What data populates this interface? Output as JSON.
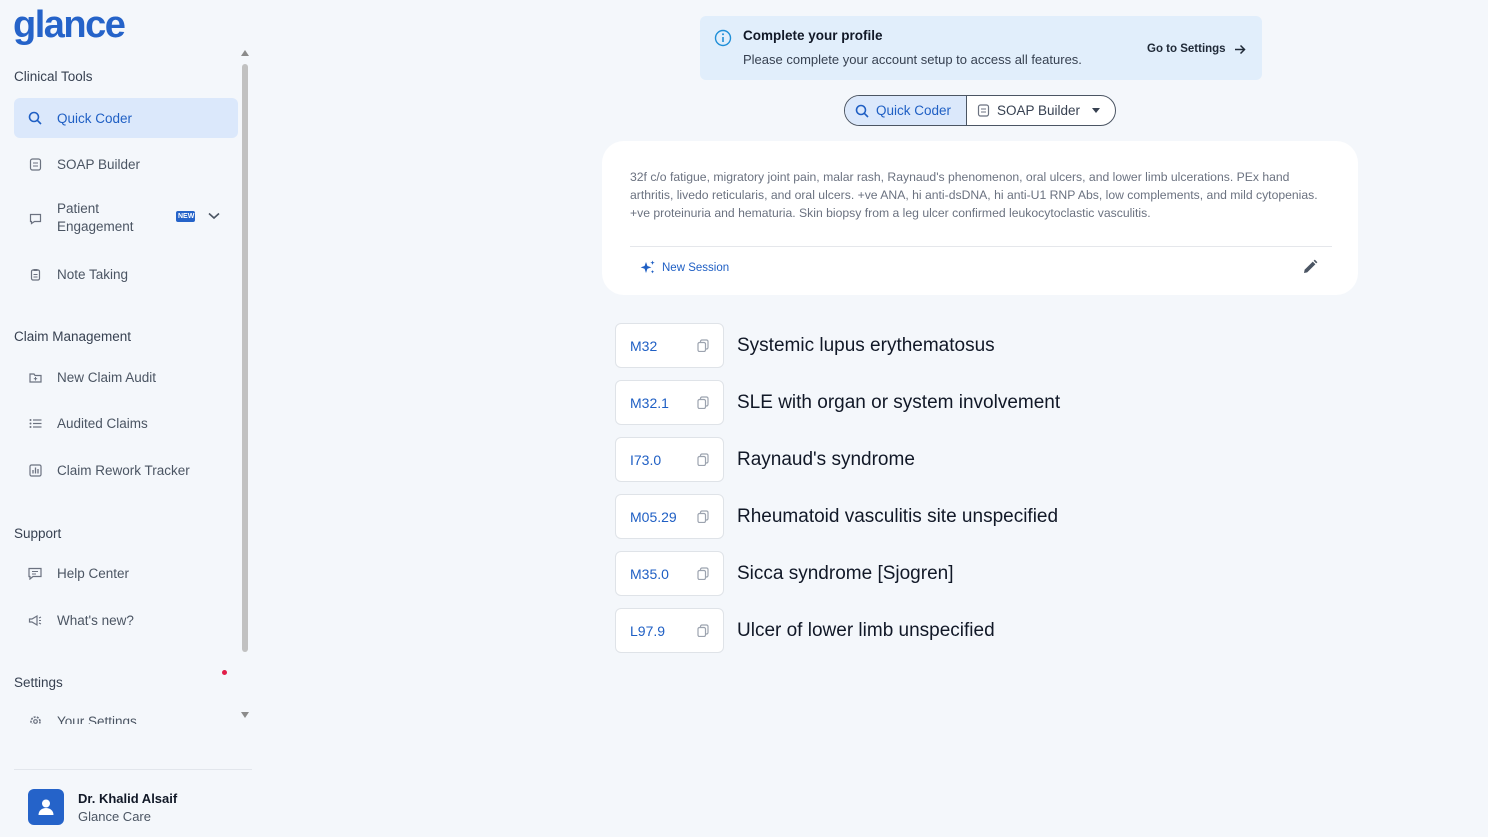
{
  "app": {
    "logo": "glance"
  },
  "sidebar": {
    "sections": [
      {
        "title": "Clinical Tools"
      },
      {
        "title": "Claim Management"
      },
      {
        "title": "Support"
      },
      {
        "title": "Settings"
      }
    ],
    "items": {
      "quick_coder": "Quick Coder",
      "soap_builder": "SOAP Builder",
      "patient_engagement": "Patient Engagement",
      "patient_engagement_badge": "NEW",
      "note_taking": "Note Taking",
      "new_claim_audit": "New Claim Audit",
      "audited_claims": "Audited Claims",
      "claim_rework_tracker": "Claim Rework Tracker",
      "help_center": "Help Center",
      "whats_new": "What's new?",
      "your_settings": "Your Settings"
    },
    "user": {
      "name": "Dr. Khalid Alsaif",
      "org": "Glance Care"
    }
  },
  "banner": {
    "title": "Complete your profile",
    "text": "Please complete your account setup to access all features.",
    "link": "Go to Settings"
  },
  "mode_toggle": {
    "active": "Quick Coder",
    "other": "SOAP Builder"
  },
  "input": {
    "note": "32f c/o fatigue, migratory joint pain, malar rash, Raynaud's phenomenon, oral ulcers, and lower limb ulcerations. PEx hand arthritis, livedo reticularis, and oral ulcers. +ve ANA, hi anti-dsDNA, hi anti-U1 RNP Abs, low complements, and mild cytopenias. +ve proteinuria and hematuria. Skin biopsy from a leg ulcer confirmed leukocytoclastic vasculitis.",
    "new_session": "New Session"
  },
  "codes": [
    {
      "code": "M32",
      "description": "Systemic lupus erythematosus"
    },
    {
      "code": "M32.1",
      "description": "SLE with organ or system involvement"
    },
    {
      "code": "I73.0",
      "description": "Raynaud's syndrome"
    },
    {
      "code": "M05.29",
      "description": "Rheumatoid vasculitis site unspecified"
    },
    {
      "code": "M35.0",
      "description": "Sicca syndrome [Sjogren]"
    },
    {
      "code": "L97.9",
      "description": "Ulcer of lower limb unspecified"
    }
  ],
  "colors": {
    "accent": "#2563c9",
    "active_bg": "#dbe8fb",
    "banner_bg": "#e1eefb"
  }
}
